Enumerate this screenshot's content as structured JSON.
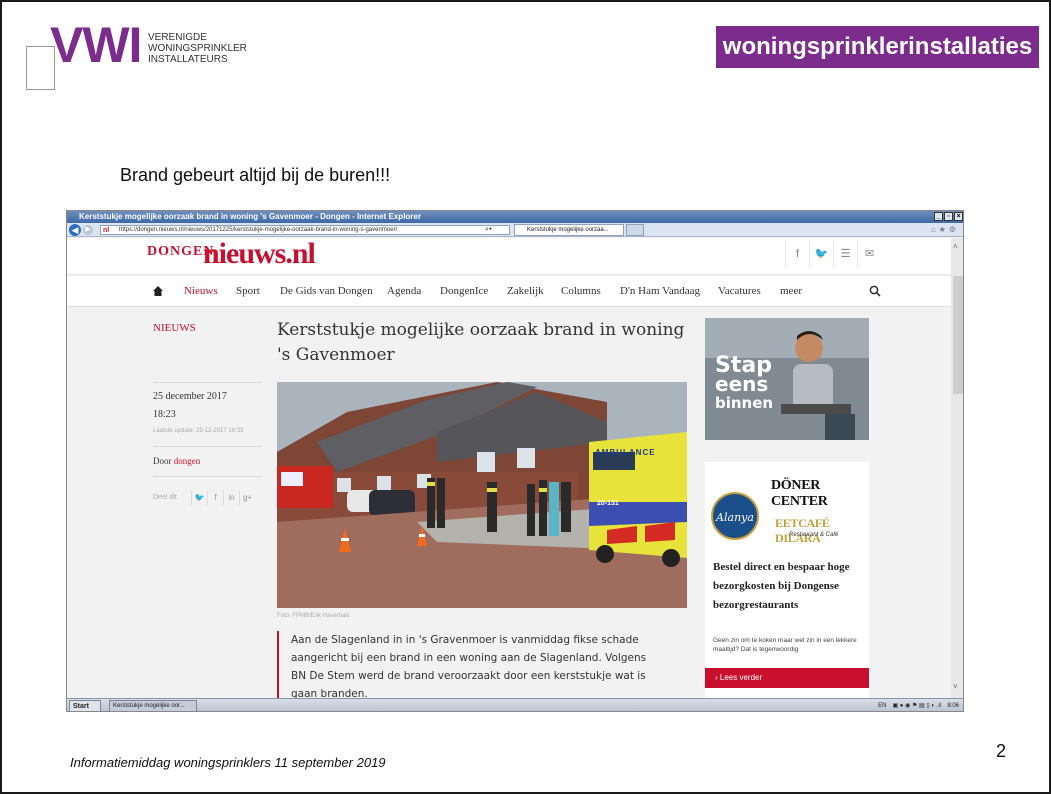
{
  "slide": {
    "logo_vwi": "VWI",
    "logo_lines": [
      "VERENIGDE",
      "WONINGSPRINKLER",
      "INSTALLATEURS"
    ],
    "brand_badge": "woningsprinklerinstallaties",
    "heading": "Brand gebeurt altijd bij de buren!!!",
    "footer": "Informatiemiddag woningsprinklers 11 september 2019",
    "page_number": "2"
  },
  "browser": {
    "title": "Kerststukje mogelijke oorzaak brand in woning 's Gavenmoer - Dongen - Internet Explorer",
    "url": "https://dongen.nieuws.nl/nieuws/20171225/kerststukje-mogelijke-oorzaak-brand-in-woning-s-gavenmoer/",
    "tab_label": "Kerststukje mogelijke oorzaa...",
    "url_badge": "nl"
  },
  "site": {
    "town": "DONGEN",
    "logo": "nieuws.nl",
    "nav": [
      "Nieuws",
      "Sport",
      "De Gids van Dongen",
      "Agenda",
      "DongenIce",
      "Zakelijk",
      "Columns",
      "D'n Ham Vandaag",
      "Vacatures",
      "meer"
    ],
    "active_nav": "Nieuws"
  },
  "article": {
    "section": "NIEUWS",
    "title": "Kerststukje mogelijke oorzaak brand in woning 's Gavenmoer",
    "date": "25 december 2017",
    "time": "18:23",
    "last_update": "Laatste update: 25-12-2017 18:33",
    "author_prefix": "Door",
    "author": "dongen",
    "share_label": "Deel dit",
    "photo_caption": "Foto: FPMB/Erik Haverhals",
    "ambulance_label": "AMBULANCE",
    "ambulance_number": "20-131",
    "body": "Aan de Slagenland in in 's Gravenmoer is vanmiddag fikse schade aangericht bij een brand in een woning aan de Slagenland. Volgens BN De Stem werd de brand veroorzaakt door een kerststukje wat is gaan branden."
  },
  "ads": {
    "stap_line1": "Stap",
    "stap_line2": "eens",
    "stap_line3": "binnen",
    "doner": "DÖNER CENTER",
    "alanya": "Alanya",
    "eetcafe": "EETCAFÉ DILARA",
    "eetcafe_sub": "Restaurant & Café",
    "headline": "Bestel direct en bespaar hoge bezorgkosten bij Dongense bezorgrestaurants",
    "subtext": "Geen zin om te koken maar wel zin in een lekkere maaltijd? Dat is tegenwoordig",
    "cta": "Lees verder"
  },
  "taskbar": {
    "start": "Start",
    "task": "Kerststukje mogelijke oor...",
    "lang": "EN",
    "clock": "8:06"
  },
  "colors": {
    "brand_purple": "#7b2c8c",
    "news_red": "#c8102e"
  }
}
